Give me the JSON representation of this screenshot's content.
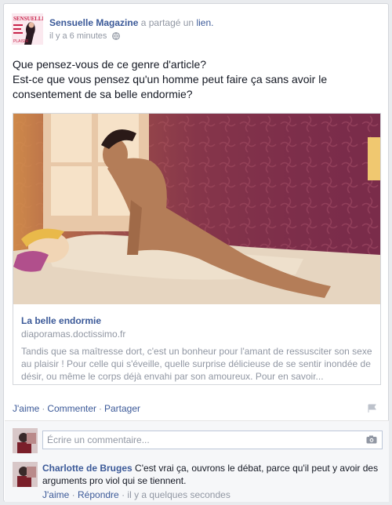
{
  "post": {
    "author": "Sensuelle Magazine",
    "action_text": "a partagé un",
    "action_link": "lien.",
    "time": "il y a 6 minutes",
    "avatar_text": "SENSUELLE",
    "avatar_sub": "PLAISIR",
    "text_line1": "Que pensez-vous de ce genre d'article?",
    "text_line2": "Est-ce que vous pensez qu'un homme peut faire ça sans avoir le consentement de sa belle endormie?"
  },
  "attachment": {
    "title": "La belle endormie",
    "domain": "diaporamas.doctissimo.fr",
    "description": "Tandis que sa maîtresse dort, c'est un bonheur pour l'amant de ressusciter son sexe au plaisir ! Pour celle qui s'éveille, quelle surprise délicieuse de se sentir inondée de désir, ou même le corps déjà envahi par son amoureux. Pour en savoir..."
  },
  "actions": {
    "like": "J'aime",
    "comment": "Commenter",
    "share": "Partager",
    "separator": "·"
  },
  "comment_box": {
    "placeholder": "Écrire un commentaire..."
  },
  "comment": {
    "author": "Charlotte de Bruges",
    "text": "C'est vrai ça, ouvrons le débat, parce qu'il peut y avoir des arguments pro viol qui se tiennent.",
    "like": "J'aime",
    "reply": "Répondre",
    "time": "il y a quelques secondes",
    "separator": "·"
  },
  "colors": {
    "link_blue": "#3b5998",
    "meta_grey": "#9197a3",
    "wallpaper_purple": "#7a2c4a"
  }
}
